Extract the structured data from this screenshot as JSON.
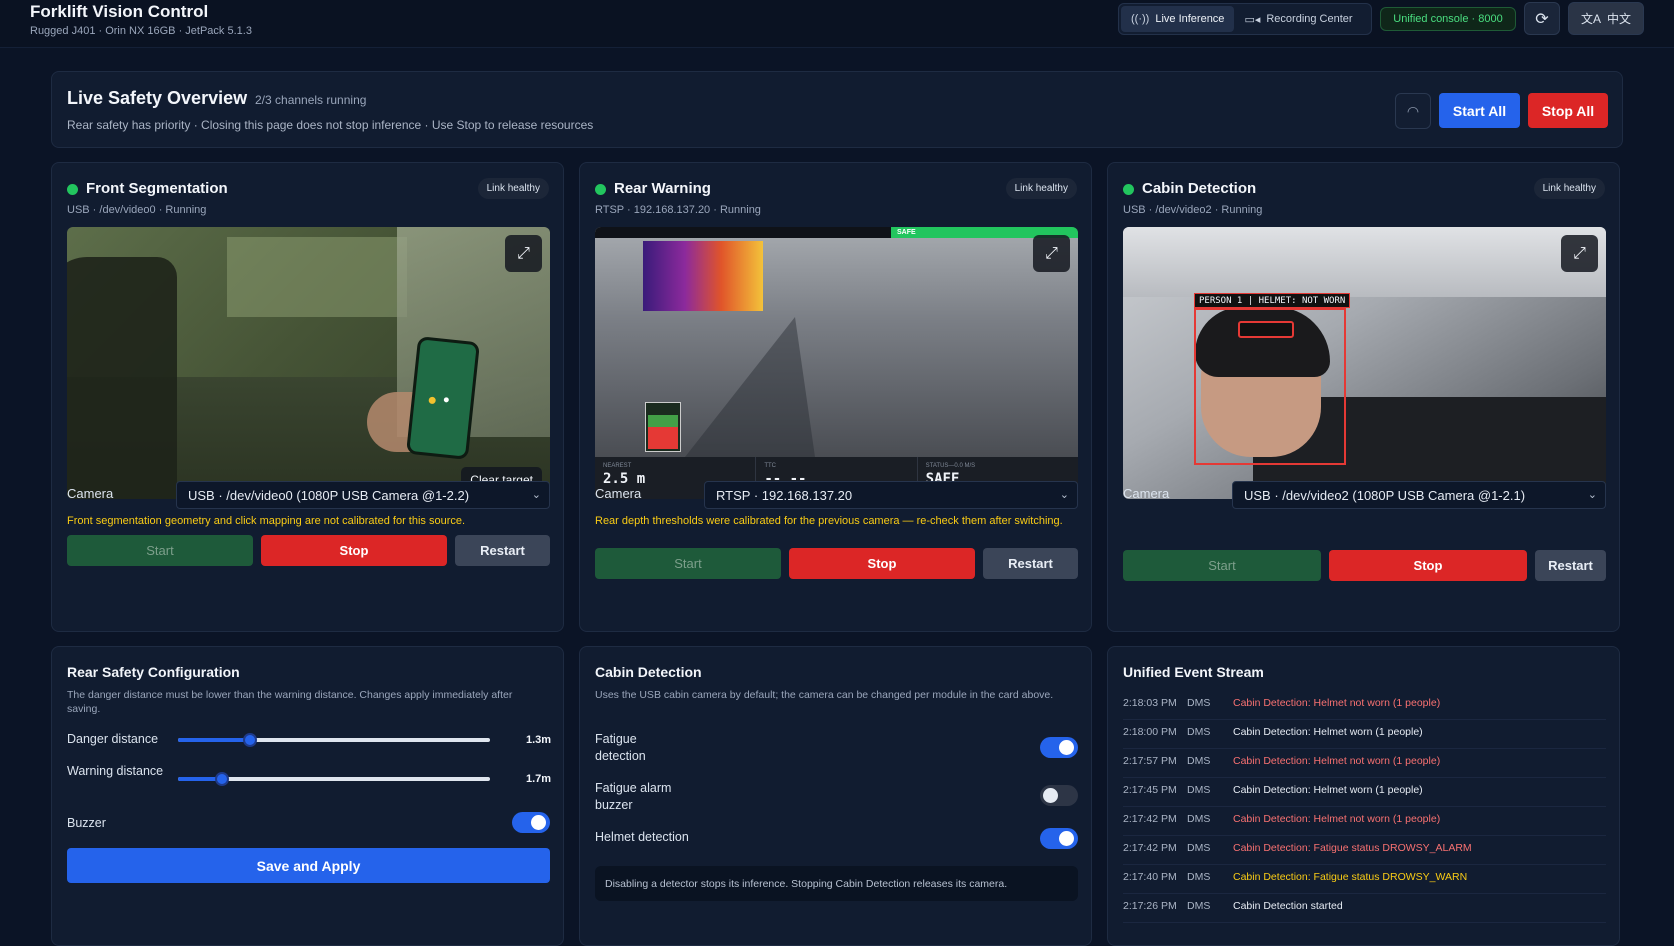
{
  "app": {
    "title": "Forklift Vision Control",
    "subtitle": "Rugged J401 · Orin NX 16GB · JetPack 5.1.3"
  },
  "nav": {
    "live_label": "Live Inference",
    "recording_label": "Recording Center",
    "console_badge": "Unified console · 8000",
    "lang_label": "中文",
    "icons": {
      "live": "broadcast-icon",
      "recording": "video-camera-icon",
      "refresh": "refresh-icon",
      "lang": "translate-icon"
    }
  },
  "overview": {
    "title": "Live Safety Overview",
    "count": "2/3 channels running",
    "subtitle": "Rear safety has priority · Closing this page does not stop inference · Use Stop to release resources",
    "start_all": "Start All",
    "stop_all": "Stop All"
  },
  "colors": {
    "accent_blue": "#2563eb",
    "stop_red": "#dc2626",
    "running_green": "#22c55e",
    "warning_yellow": "#facc15",
    "alert_red": "#f87171"
  },
  "channels": [
    {
      "title": "Front Segmentation",
      "status_badge": "Link healthy",
      "sub": "USB · /dev/video0 · Running",
      "camera_label": "Camera",
      "camera_value": "USB · /dev/video0 (1080P USB Camera @1-2.2)",
      "warning": "Front segmentation geometry and click mapping are not calibrated for this source.",
      "clear_target": "Clear target",
      "start": "Start",
      "stop": "Stop",
      "restart": "Restart"
    },
    {
      "title": "Rear Warning",
      "status_badge": "Link healthy",
      "sub": "RTSP · 192.168.137.20 · Running",
      "camera_label": "Camera",
      "camera_value": "RTSP · 192.168.137.20",
      "warning": "Rear depth thresholds were calibrated for the previous camera — re-check them after switching.",
      "overlay": {
        "safe_tag": "SAFE",
        "nearest_label": "NEAREST",
        "nearest_value": "2.5 m",
        "ttc_label": "TTC",
        "ttc_value": "-- --",
        "status_label": "STATUS—0.0 m/s",
        "status_value": "SAFE"
      },
      "start": "Start",
      "stop": "Stop",
      "restart": "Restart"
    },
    {
      "title": "Cabin Detection",
      "status_badge": "Link healthy",
      "sub": "USB · /dev/video2 · Running",
      "camera_label": "Camera",
      "camera_value": "USB · /dev/video2 (1080P USB Camera @1-2.1)",
      "detection_label": "PERSON 1 | HELMET: NOT WORN",
      "start": "Start",
      "stop": "Stop",
      "restart": "Restart"
    }
  ],
  "rear_config": {
    "title": "Rear Safety Configuration",
    "desc": "The danger distance must be lower than the warning distance. Changes apply immediately after saving.",
    "danger_label": "Danger distance",
    "danger_value": "1.3m",
    "danger_fraction": 0.23,
    "warning_label": "Warning distance",
    "warning_value": "1.7m",
    "warning_fraction": 0.14,
    "buzzer_label": "Buzzer",
    "buzzer_on": true,
    "save_label": "Save and Apply"
  },
  "cabin_config": {
    "title": "Cabin Detection",
    "desc": "Uses the USB cabin camera by default; the camera can be changed per module in the card above.",
    "fatigue_label": "Fatigue detection",
    "fatigue_on": true,
    "buzzer_label": "Fatigue alarm buzzer",
    "buzzer_on": false,
    "helmet_label": "Helmet detection",
    "helmet_on": true,
    "note": "Disabling a detector stops its inference. Stopping Cabin Detection releases its camera."
  },
  "events": {
    "title": "Unified Event Stream",
    "items": [
      {
        "time": "2:18:03 PM",
        "source": "DMS",
        "message": "Cabin Detection: Helmet not worn (1 people)",
        "level": "red"
      },
      {
        "time": "2:18:00 PM",
        "source": "DMS",
        "message": "Cabin Detection: Helmet worn (1 people)",
        "level": "normal"
      },
      {
        "time": "2:17:57 PM",
        "source": "DMS",
        "message": "Cabin Detection: Helmet not worn (1 people)",
        "level": "red"
      },
      {
        "time": "2:17:45 PM",
        "source": "DMS",
        "message": "Cabin Detection: Helmet worn (1 people)",
        "level": "normal"
      },
      {
        "time": "2:17:42 PM",
        "source": "DMS",
        "message": "Cabin Detection: Helmet not worn (1 people)",
        "level": "red"
      },
      {
        "time": "2:17:42 PM",
        "source": "DMS",
        "message": "Cabin Detection: Fatigue status DROWSY_ALARM",
        "level": "red"
      },
      {
        "time": "2:17:40 PM",
        "source": "DMS",
        "message": "Cabin Detection: Fatigue status DROWSY_WARN",
        "level": "amber"
      },
      {
        "time": "2:17:26 PM",
        "source": "DMS",
        "message": "Cabin Detection started",
        "level": "normal"
      }
    ]
  }
}
